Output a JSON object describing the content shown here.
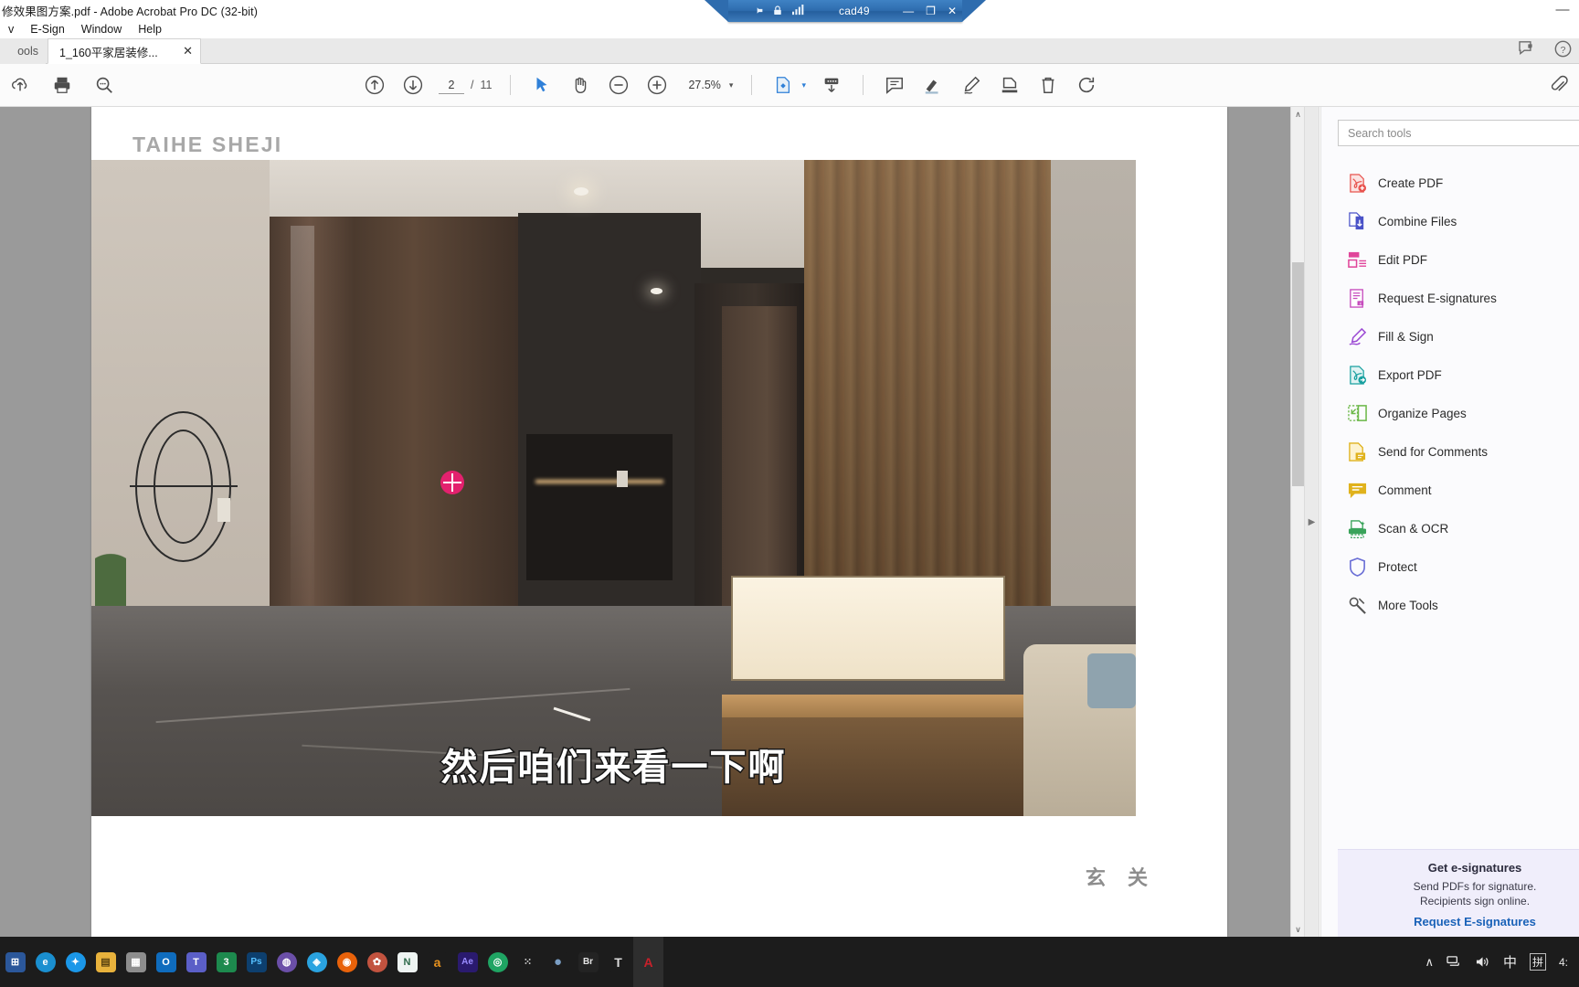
{
  "window": {
    "title": "修效果图方案.pdf - Adobe Acrobat Pro DC (32-bit)",
    "close_glyph": "—"
  },
  "menubar": {
    "items": [
      {
        "label": "v"
      },
      {
        "label": "E-Sign"
      },
      {
        "label": "Window"
      },
      {
        "label": "Help"
      }
    ]
  },
  "remote_bar": {
    "pin_icon": "pin-icon",
    "lock_icon": "lock-icon",
    "signal_icon": "signal-icon",
    "name": "cad49",
    "minimize": "—",
    "restore": "❐",
    "close": "✕"
  },
  "tabstrip": {
    "tools_tab": "ools",
    "doc_tab": "1_160平家居装修...",
    "close_glyph": "✕",
    "feedback_icon": "feedback-icon",
    "help_icon": "help-circle-icon"
  },
  "toolbar": {
    "left_icons": [
      {
        "name": "upload-cloud-icon",
        "glyph": "upload"
      },
      {
        "name": "print-icon",
        "glyph": "print"
      },
      {
        "name": "search-icon",
        "glyph": "search"
      }
    ],
    "prev_page_icon": "arrow-up-circle-icon",
    "next_page_icon": "arrow-down-circle-icon",
    "page_current": "2",
    "page_separator": "/",
    "page_total": "11",
    "select_tool_icon": "cursor-arrow-icon",
    "hand_tool_icon": "hand-icon",
    "zoom_out_icon": "minus-circle-icon",
    "zoom_in_icon": "plus-circle-icon",
    "zoom_value": "27.5%",
    "zoom_caret": "▾",
    "fit_page_icon": "fit-page-icon",
    "fit_caret": "▾",
    "scroll_mode_icon": "page-down-icon",
    "comment_icon": "comment-bubble-icon",
    "highlight_icon": "highlighter-icon",
    "draw_icon": "pen-draw-icon",
    "stamp_icon": "add-stamp-icon",
    "delete_icon": "trash-icon",
    "rotate_icon": "rotate-icon",
    "attach_icon": "paperclip-icon"
  },
  "document": {
    "brand": "TAIHE SHEJI",
    "room_caption": "玄 关",
    "subtitle": "然后咱们来看一下啊"
  },
  "scrollbar": {
    "up_glyph": "∧",
    "down_glyph": "∨"
  },
  "tools_pane": {
    "splitter_arrow": "▶",
    "search_placeholder": "Search tools",
    "items": [
      {
        "label": "Create PDF",
        "icon": "create-pdf-icon",
        "color": "#e8534e"
      },
      {
        "label": "Combine Files",
        "icon": "combine-files-icon",
        "color": "#4a52c8"
      },
      {
        "label": "Edit PDF",
        "icon": "edit-pdf-icon",
        "color": "#e0459a"
      },
      {
        "label": "Request E-signatures",
        "icon": "request-esign-icon",
        "color": "#c64bbd"
      },
      {
        "label": "Fill & Sign",
        "icon": "fill-sign-icon",
        "color": "#9c4bd4"
      },
      {
        "label": "Export PDF",
        "icon": "export-pdf-icon",
        "color": "#18a0a0"
      },
      {
        "label": "Organize Pages",
        "icon": "organize-pages-icon",
        "color": "#6cb849"
      },
      {
        "label": "Send for Comments",
        "icon": "send-comments-icon",
        "color": "#e0b21c"
      },
      {
        "label": "Comment",
        "icon": "comment-icon",
        "color": "#e0b21c"
      },
      {
        "label": "Scan & OCR",
        "icon": "scan-ocr-icon",
        "color": "#39a35a"
      },
      {
        "label": "Protect",
        "icon": "protect-shield-icon",
        "color": "#6b6fd6"
      },
      {
        "label": "More Tools",
        "icon": "more-tools-icon",
        "color": "#555555"
      }
    ],
    "promo": {
      "title": "Get e-signatures",
      "line1": "Send PDFs for signature.",
      "line2": "Recipients sign online.",
      "link": "Request E-signatures"
    }
  },
  "taskbar": {
    "apps": [
      {
        "name": "start-icon",
        "label": "⊞",
        "color": "#2b579a"
      },
      {
        "name": "edge-icon",
        "label": "e",
        "color": "#1a8fd0"
      },
      {
        "name": "store-icon",
        "label": "✦",
        "color": "#1b97e8"
      },
      {
        "name": "file-explorer-icon",
        "label": "▤",
        "color": "#e8b23c"
      },
      {
        "name": "calculator-icon",
        "label": "▦",
        "color": "#8d8d8d"
      },
      {
        "name": "outlook-icon",
        "label": "O",
        "color": "#0f6cbd"
      },
      {
        "name": "teams-icon",
        "label": "T",
        "color": "#5b5fc7"
      },
      {
        "name": "excel-icon",
        "label": "3",
        "color": "#1d8a4e"
      },
      {
        "name": "photoshop-icon",
        "label": "Ps",
        "color": "#0d3f6e"
      },
      {
        "name": "sketchup-icon",
        "label": "◍",
        "color": "#6b4fa8"
      },
      {
        "name": "dropbox-icon",
        "label": "◈",
        "color": "#2aa3e0"
      },
      {
        "name": "firefox-icon",
        "label": "◉",
        "color": "#e8620a"
      },
      {
        "name": "pinwheel-icon",
        "label": "✿",
        "color": "#c2533f"
      },
      {
        "name": "cad-icon",
        "label": "N",
        "color": "#2d6a4a"
      },
      {
        "name": "amazon-icon",
        "label": "a",
        "color": "#e8931f"
      },
      {
        "name": "aftereffects-icon",
        "label": "Ae",
        "color": "#2a1a6e"
      },
      {
        "name": "chrome-icon",
        "label": "◎",
        "color": "#1fa463"
      },
      {
        "name": "ocr-icon",
        "label": "⁙",
        "color": "#bdbdbd"
      },
      {
        "name": "color-mixer-icon",
        "label": "●",
        "color": "#7a9ec4"
      },
      {
        "name": "bridge-icon",
        "label": "Br",
        "color": "#232323"
      },
      {
        "name": "tim-icon",
        "label": "T",
        "color": "#5b6a7a"
      },
      {
        "name": "acrobat-icon",
        "label": "A",
        "color": "#c8202a"
      }
    ],
    "tray": {
      "chevron": "∧",
      "network_icon": "network-icon",
      "volume_icon": "volume-icon",
      "ime_mode": "中",
      "ime_pinyin": "拼",
      "time": "4:"
    }
  }
}
